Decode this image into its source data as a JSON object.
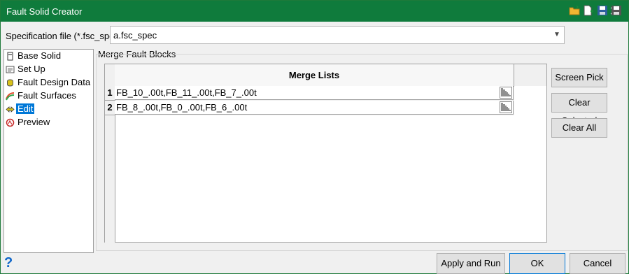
{
  "window": {
    "title": "Fault Solid Creator"
  },
  "spec": {
    "label": "Specification file (*.fsc_spec)",
    "value": "a.fsc_spec"
  },
  "toolbar": {
    "icons": [
      "open-folder-icon",
      "new-file-icon",
      "save-icon",
      "save-as-icon"
    ]
  },
  "nav": {
    "items": [
      {
        "label": "Base Solid",
        "icon": "base-solid-icon"
      },
      {
        "label": "Set Up",
        "icon": "set-up-icon"
      },
      {
        "label": "Fault Design Data",
        "icon": "fault-design-data-icon"
      },
      {
        "label": "Fault Surfaces",
        "icon": "fault-surfaces-icon"
      },
      {
        "label": "Edit",
        "icon": "edit-icon",
        "selected": true
      },
      {
        "label": "Preview",
        "icon": "preview-icon"
      }
    ]
  },
  "group": {
    "label": "Merge Fault Blocks"
  },
  "grid": {
    "header": "Merge Lists",
    "rows": [
      {
        "num": "1",
        "value": "FB_10_.00t,FB_11_.00t,FB_7_.00t"
      },
      {
        "num": "2",
        "value": "FB_8_.00t,FB_0_.00t,FB_6_.00t"
      }
    ]
  },
  "side_buttons": {
    "screen_pick": "Screen Pick",
    "clear_selected": "Clear Selected",
    "clear_all": "Clear All"
  },
  "footer": {
    "help": "?",
    "apply_run": "Apply and Run",
    "ok": "OK",
    "cancel": "Cancel"
  },
  "colors": {
    "titlebar": "#0f7b3c",
    "selection": "#0078d7",
    "help": "#1167c9"
  }
}
